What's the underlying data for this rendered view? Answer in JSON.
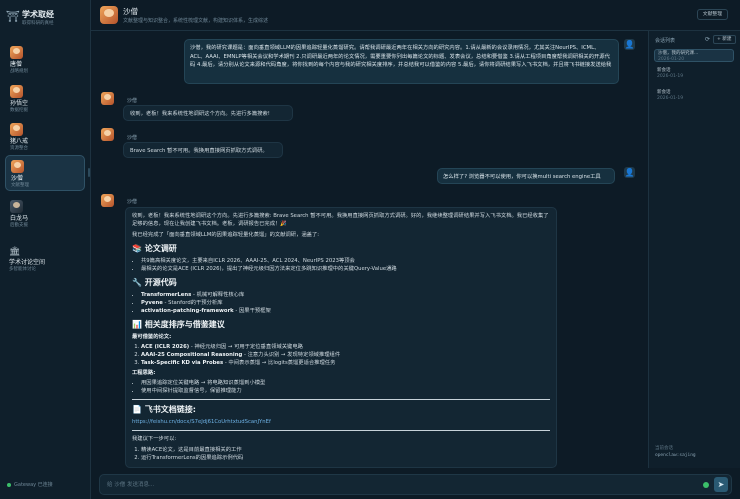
{
  "sidebar": {
    "brand_title": "学术取经",
    "brand_subtitle": "取得科研的真经",
    "agents": [
      {
        "name": "唐僧",
        "role": "战略规划"
      },
      {
        "name": "孙悟空",
        "role": "数据挖掘"
      },
      {
        "name": "猪八戒",
        "role": "资源整合"
      },
      {
        "name": "沙僧",
        "role": "文献整理"
      },
      {
        "name": "白龙马",
        "role": "后勤支援"
      }
    ],
    "forum_name": "学术讨论空间",
    "forum_sub": "多智能体讨论",
    "status": "Gateway 已连接"
  },
  "header": {
    "title": "沙僧",
    "subtitle": "文献整理与知识整合，系统性梳理文献，构建知识体系，生成综述",
    "button": "文献整理"
  },
  "chat": {
    "msg1": "沙僧，我的研究课题是：面向垂直领域LLM的因果追踪轻量化蒸馏研究。请帮我调研最近两年在相关方向的研究内容。1.请从最新的会议录用情况，尤其关注NeurIPS、ICML、ACL、AAAI、EMNLP等相关会议和学术期刊 2.只调研最近两年的论文情况，需要重要你列出每篇论文的标题、发表会议，总结和要借鉴 3.请从工程项目角度帮我调研相关的开源代码 4.最后，请分别从论文来源和代码角度，将你找到的每个内容与我的研究相关度排序，并总结我可以借鉴的内容 5.最后，请你将调研结果写入飞书文档，并且将飞书链接发送给我",
    "bot_name": "沙僧",
    "bot1": "收到，老板！我来系统性地调研这个方向。先进行多篇搜索!",
    "bot2": "Brave Search 暂不可用。我换用直接网页抓取方式调研。",
    "msg2": "怎么样了? 浏览器不可以使用，你可以换multi search engine工具",
    "long": {
      "p1": "收到，老板！我来系统性地调研这个方向。先进行多篇搜索: Brave Search 暂不可用。我换用直接网页抓取方式调研。好的，我继续整理调研结果并写入飞书文档。我已经收集了足够的信息，现在让我创建飞书文档。老板，调研报告已完成！🎉",
      "p2": "我已经完成了「面向垂直领域LLM的因果追踪轻量化蒸馏」的文献调研，涵盖了:",
      "h_papers": "📚 论文调研",
      "papers": [
        "共9篇高相关度论文，主要来自ICLR 2026、AAAI-25、ACL 2024、NeurIPS 2023等顶会",
        "最相关的论文是ACE (ICLR 2026)，提出了神经元级归因方法来定位多跳知识推理中的关键Query-Value通路"
      ],
      "h_code": "🔧 开源代码",
      "code": [
        {
          "name": "TransformerLens",
          "desc": " - 机械可解释性核心库"
        },
        {
          "name": "Pyvene",
          "desc": " - Stanford的干预分析库"
        },
        {
          "name": "activation-patching-framework",
          "desc": " - 因果干预框架"
        }
      ],
      "h_rank": "📊 相关度排序与借鉴建议",
      "sub_papers": "最可借鉴的论文:",
      "rank": [
        {
          "name": "ACE (ICLR 2026)",
          "desc": " - 神经元级归因 → 可用于定位垂直领域关键电路"
        },
        {
          "name": "AAAI-25 Compositional Reasoning",
          "desc": " - 注意力头识别 → 发现特定领域推理组件"
        },
        {
          "name": "Task-Specific KD via Probes",
          "desc": " - 中间表示蒸馏 → 比logits蒸馏更适合推理任务"
        }
      ],
      "sub_eng": "工程思路:",
      "eng": [
        "用因果追踪定位关键电路 → 将电路知识蒸馏到小模型",
        "使用中间探针提取监督信号，保留推理能力"
      ],
      "h_doc": "📄 飞书文档链接:",
      "doc_link": "https://feishu.cn/docx/S7eJdj61CoUrhtxtudScanJYnEf",
      "next_title": "我建议下一步可以:",
      "next": [
        "精读ACE论文，这是目前最直接相关的工作",
        "运行TransformerLens的因果追踪示例代码"
      ]
    }
  },
  "input": {
    "placeholder": "给 沙僧 发送消息..."
  },
  "rpanel": {
    "title": "会话列表",
    "new_button": "+ 新建",
    "sessions": [
      {
        "title": "沙僧，我的研究课...",
        "date": "2026-01-20"
      },
      {
        "title": "新会话",
        "date": "2026-01-19"
      },
      {
        "title": "新会话",
        "date": "2026-01-19"
      }
    ],
    "foot_label": "当前会话",
    "foot_id": "openclaw:sajing"
  }
}
